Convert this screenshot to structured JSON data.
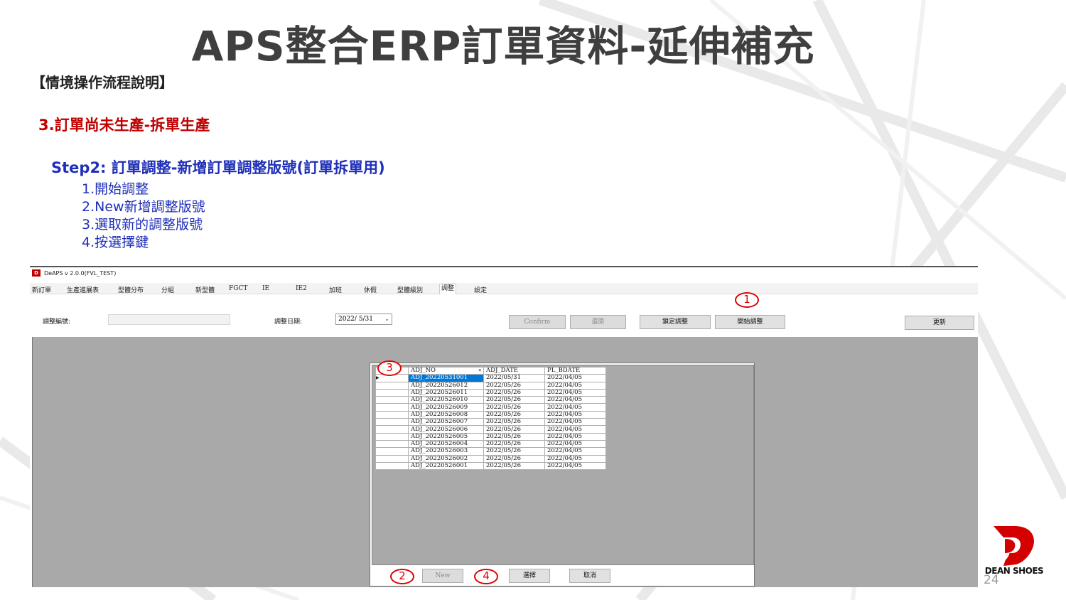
{
  "slide": {
    "title": "APS整合ERP訂單資料-延伸補充",
    "section": "【情境操作流程說明】",
    "case": "3.訂單尚未生產-拆單生產",
    "step": "Step2: 訂單調整-新增訂單調整版號(訂單拆單用)",
    "steps": [
      "1.開始調整",
      "2.New新增調整版號",
      "3.選取新的調整版號",
      "4.按選擇鍵"
    ],
    "page_number": "24",
    "logo_text": "DEAN SHOES"
  },
  "app": {
    "title": "DeAPS v 2.0.0(FVL_TEST)",
    "menu": [
      "新訂單",
      "生產進展表",
      "型體分布",
      "分組",
      "新型體",
      "FGCT",
      "IE",
      "IE2",
      "加班",
      "休假",
      "型體級別",
      "調整",
      "設定"
    ],
    "active_menu": "調整",
    "form": {
      "adj_no_label": "調整編號:",
      "adj_no_value": "",
      "adj_date_label": "調整日期:",
      "adj_date_value": "2022/ 5/31"
    },
    "buttons": {
      "confirm": "Confirm",
      "restore": "還原",
      "lock": "鎖定調整",
      "start": "開始調整",
      "refresh": "更新"
    },
    "dialog": {
      "columns": [
        "ADJ_NO",
        "ADJ_DATE",
        "PL_BDATE"
      ],
      "rows": [
        [
          "ADJ_20220531001",
          "2022/05/31",
          "2022/04/05"
        ],
        [
          "ADJ_20220526012",
          "2022/05/26",
          "2022/04/05"
        ],
        [
          "ADJ_20220526011",
          "2022/05/26",
          "2022/04/05"
        ],
        [
          "ADJ_20220526010",
          "2022/05/26",
          "2022/04/05"
        ],
        [
          "ADJ_20220526009",
          "2022/05/26",
          "2022/04/05"
        ],
        [
          "ADJ_20220526008",
          "2022/05/26",
          "2022/04/05"
        ],
        [
          "ADJ_20220526007",
          "2022/05/26",
          "2022/04/05"
        ],
        [
          "ADJ_20220526006",
          "2022/05/26",
          "2022/04/05"
        ],
        [
          "ADJ_20220526005",
          "2022/05/26",
          "2022/04/05"
        ],
        [
          "ADJ_20220526004",
          "2022/05/26",
          "2022/04/05"
        ],
        [
          "ADJ_20220526003",
          "2022/05/26",
          "2022/04/05"
        ],
        [
          "ADJ_20220526002",
          "2022/05/26",
          "2022/04/05"
        ],
        [
          "ADJ_20220526001",
          "2022/05/26",
          "2022/04/05"
        ]
      ],
      "selected_row": 0,
      "buttons": {
        "new": "New",
        "select": "選擇",
        "cancel": "取消"
      }
    }
  },
  "markers": [
    "1",
    "2",
    "3",
    "4"
  ],
  "colors": {
    "accent_red": "#e00000",
    "step_blue": "#1f2fb8",
    "case_red": "#c00000",
    "selection_blue": "#0078d7"
  }
}
